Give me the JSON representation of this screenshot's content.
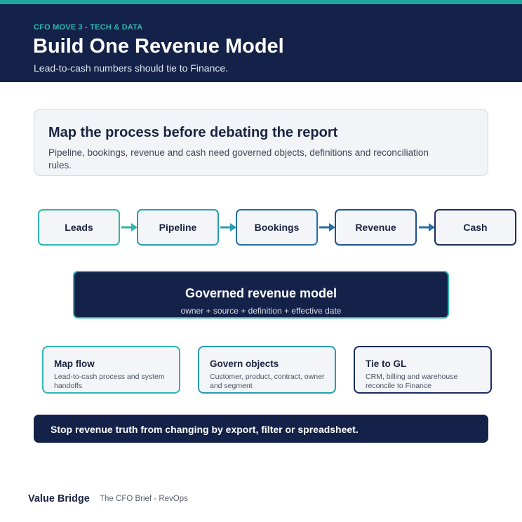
{
  "header": {
    "eyebrow": "CFO MOVE 3 - TECH & DATA",
    "title": "Build One Revenue Model",
    "subtitle": "Lead-to-cash numbers should tie to Finance."
  },
  "intro": {
    "title": "Map the process before debating the report",
    "body": "Pipeline, bookings, revenue and cash need governed objects, definitions and reconciliation rules."
  },
  "flow": {
    "steps": [
      "Leads",
      "Pipeline",
      "Bookings",
      "Revenue",
      "Cash"
    ],
    "colors": [
      "#2fb7ae",
      "#2a9db2",
      "#256fa6",
      "#1f4f8f",
      "#1c2d5c"
    ]
  },
  "model": {
    "title": "Governed revenue model",
    "subtitle": "owner + source + definition + effective date"
  },
  "cards": [
    {
      "title": "Map flow",
      "body": "Lead-to-cash process and system handoffs"
    },
    {
      "title": "Govern objects",
      "body": "Customer, product, contract, owner and segment"
    },
    {
      "title": "Tie to GL",
      "body": "CRM, billing and warehouse reconcile to Finance"
    }
  ],
  "banner": {
    "text": "Stop revenue truth from changing by export, filter or spreadsheet."
  },
  "footer": {
    "brand": "Value Bridge",
    "tagline": "The CFO Brief - RevOps"
  },
  "colors": {
    "navy": "#142148",
    "teal": "#2fb7ae",
    "white": "#ffffff"
  }
}
